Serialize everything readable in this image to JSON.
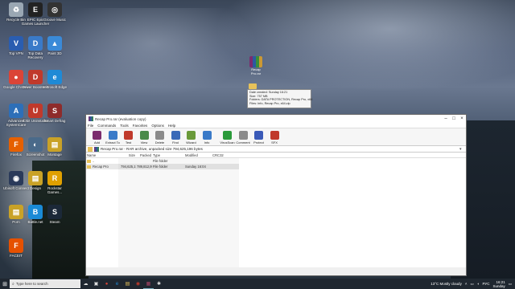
{
  "desktop_icons": [
    {
      "label": "Recycle Bin",
      "icon": "recycle-bin-icon",
      "color": "#9aa7b3",
      "glyph": "♻"
    },
    {
      "label": "EPIC Epic Games Launcher",
      "icon": "epic-games-icon",
      "color": "#222222",
      "glyph": "E"
    },
    {
      "label": "Groove Music",
      "icon": "groove-music-icon",
      "color": "#333333",
      "glyph": "◎"
    },
    {
      "label": "Top VPN",
      "icon": "vpn-icon",
      "color": "#2a5db0",
      "glyph": "V"
    },
    {
      "label": "Top Data Recovery",
      "icon": "data-recovery-icon",
      "color": "#3a7ac8",
      "glyph": "D"
    },
    {
      "label": "Paint 3D",
      "icon": "paint3d-icon",
      "color": "#3a8ad8",
      "glyph": "▲"
    },
    {
      "label": "Google Chrome",
      "icon": "chrome-icon",
      "color": "#db4437",
      "glyph": "●"
    },
    {
      "label": "Driver Booster 8",
      "icon": "driver-booster-icon",
      "color": "#c0392b",
      "glyph": "D"
    },
    {
      "label": "Microsoft Edge",
      "icon": "edge-icon",
      "color": "#1f8ad6",
      "glyph": "e"
    },
    {
      "label": "Advanced SystemCare",
      "icon": "systemcare-icon",
      "color": "#2d6fb8",
      "glyph": "A"
    },
    {
      "label": "IObit Uninstaller",
      "icon": "uninstaller-icon",
      "color": "#c0392b",
      "glyph": "U"
    },
    {
      "label": "Smart Defrag",
      "icon": "defrag-icon",
      "color": "#8e2b2b",
      "glyph": "S"
    },
    {
      "label": "Firefox",
      "icon": "firefox-icon",
      "color": "#e66000",
      "glyph": "F"
    },
    {
      "label": "Screenshot",
      "icon": "screenshot-icon",
      "color": "#4a6a8a",
      "glyph": "◐"
    },
    {
      "label": "Montage",
      "icon": "montage-icon",
      "color": "#c9a227",
      "glyph": "▤"
    },
    {
      "label": "Ubisoft Connect",
      "icon": "ubisoft-icon",
      "color": "#2a3a5a",
      "glyph": "◉"
    },
    {
      "label": "Design",
      "icon": "folder-icon",
      "color": "#c9a227",
      "glyph": "▤"
    },
    {
      "label": "Rockstar Games...",
      "icon": "rockstar-icon",
      "color": "#e0a000",
      "glyph": "R"
    },
    {
      "label": "Porn",
      "icon": "folder-icon",
      "color": "#c9a227",
      "glyph": "▤"
    },
    {
      "label": "Battle.net",
      "icon": "battlenet-icon",
      "color": "#1a8ad6",
      "glyph": "B"
    },
    {
      "label": "Steam",
      "icon": "steam-icon",
      "color": "#1b2838",
      "glyph": "S"
    },
    {
      "label": "FACEIT",
      "icon": "faceit-icon",
      "color": "#e65100",
      "glyph": "F"
    }
  ],
  "floating_icon": {
    "label": "Recap Pro.rar"
  },
  "tooltip": {
    "lines": [
      "Date created: Sunday 16:21",
      "Size: 757 MB",
      "Folders: DATA PROTECTION, Recap Pro, x64",
      "Files: Info, Recap Pro, x64.zip"
    ]
  },
  "window": {
    "title": "Recap Pro.rar (evaluation copy)",
    "menu": [
      "File",
      "Commands",
      "Tools",
      "Favorites",
      "Options",
      "Help"
    ],
    "toolbar": [
      {
        "label": "Add",
        "icon": "add-icon",
        "color": "#7b2c6e"
      },
      {
        "label": "Extract To",
        "icon": "extract-icon",
        "color": "#3a7ac8"
      },
      {
        "label": "Test",
        "icon": "test-icon",
        "color": "#c0392b"
      },
      {
        "label": "View",
        "icon": "view-icon",
        "color": "#4a8a4a"
      },
      {
        "label": "Delete",
        "icon": "delete-icon",
        "color": "#8a8a8a"
      },
      {
        "label": "Find",
        "icon": "find-icon",
        "color": "#3a6ab8"
      },
      {
        "label": "Wizard",
        "icon": "wizard-icon",
        "color": "#6a9a3a"
      },
      {
        "label": "Info",
        "icon": "info-icon",
        "color": "#3a7ac8"
      },
      {
        "label": "VirusScan",
        "icon": "virusscan-icon",
        "color": "#2a9a3a"
      },
      {
        "label": "Comment",
        "icon": "comment-icon",
        "color": "#8a8a8a"
      },
      {
        "label": "Protect",
        "icon": "protect-icon",
        "color": "#3a5ab8"
      },
      {
        "label": "SFX",
        "icon": "sfx-icon",
        "color": "#c0392b"
      }
    ],
    "path": "Recap Pro.rar - RAR archive, unpacked size 794,625,196 bytes",
    "columns": [
      "Name",
      "Size",
      "Packed",
      "Type",
      "Modified",
      "CRC32"
    ],
    "rows": [
      {
        "name": "..",
        "size": "",
        "packed": "",
        "type": "File folder",
        "modified": "",
        "crc": ""
      },
      {
        "name": "Recap Pro",
        "size": "794,625,196",
        "packed": "789,812,993",
        "type": "File folder",
        "modified": "Sunday 16:04",
        "crc": ""
      }
    ]
  },
  "taskbar": {
    "search_placeholder": "Type here to search",
    "weather": "13°C  Mostly cloudy",
    "lang": "РУС",
    "time": "16:21",
    "day": "Sunday"
  }
}
